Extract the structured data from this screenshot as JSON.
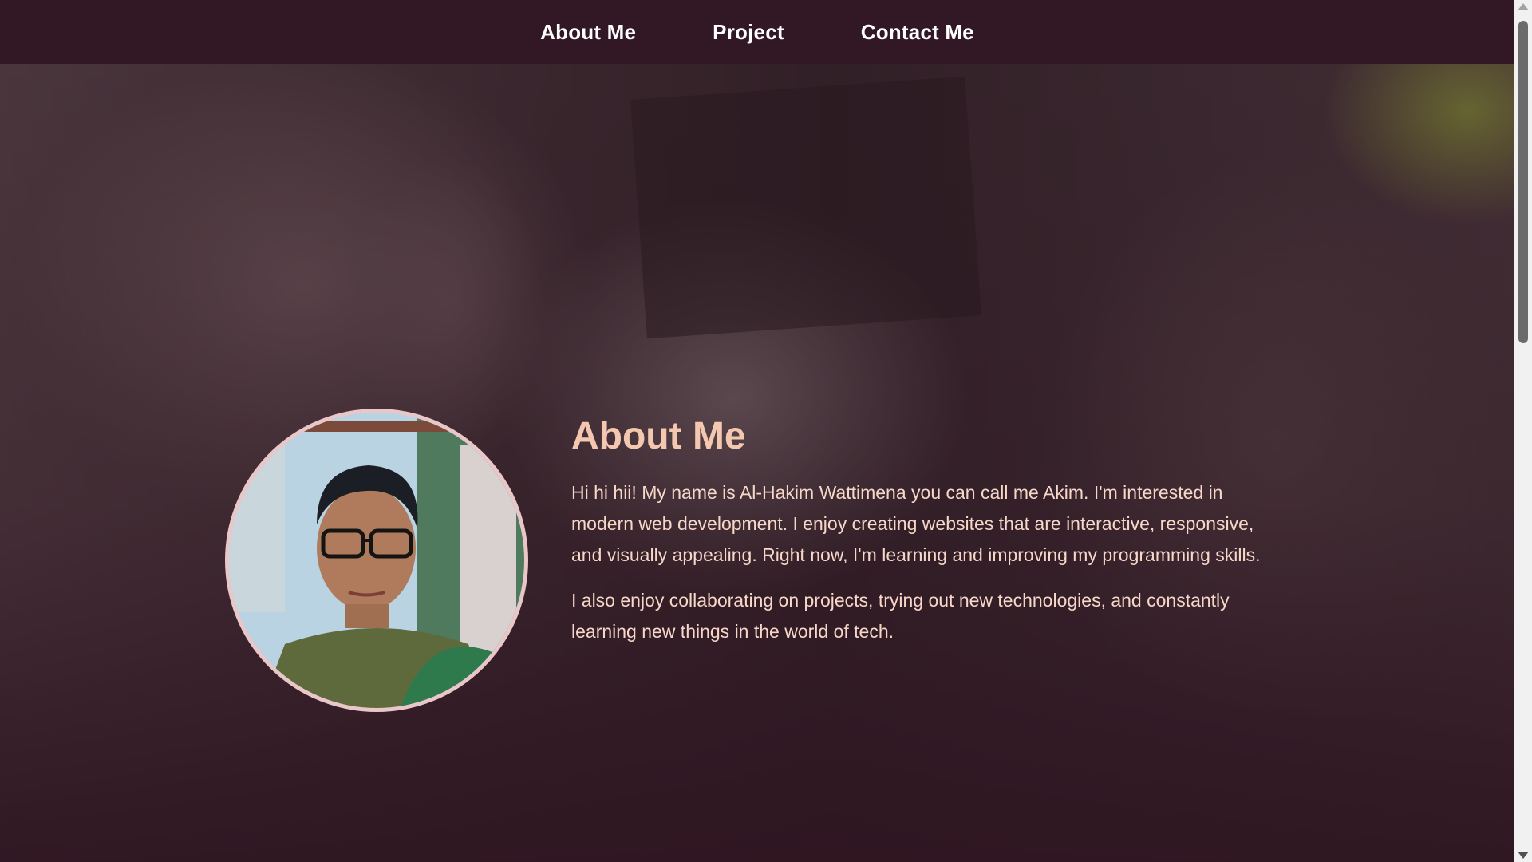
{
  "nav": {
    "items": [
      {
        "label": "About Me"
      },
      {
        "label": "Project"
      },
      {
        "label": "Contact Me"
      }
    ]
  },
  "about": {
    "title": "About Me",
    "paragraphs": [
      "Hi hi hii! My name is Al-Hakim Wattimena you can call me Akim. I'm interested in modern web development. I enjoy creating websites that are interactive, responsive, and visually appealing. Right now, I'm learning and improving my programming skills.",
      "I also enjoy collaborating on projects, trying out new technologies, and constantly learning new things in the world of tech."
    ]
  },
  "colors": {
    "nav_background": "#311824",
    "title": "#f4c8b0",
    "text": "#f6d7c8",
    "avatar_border": "#e9c6c8"
  }
}
